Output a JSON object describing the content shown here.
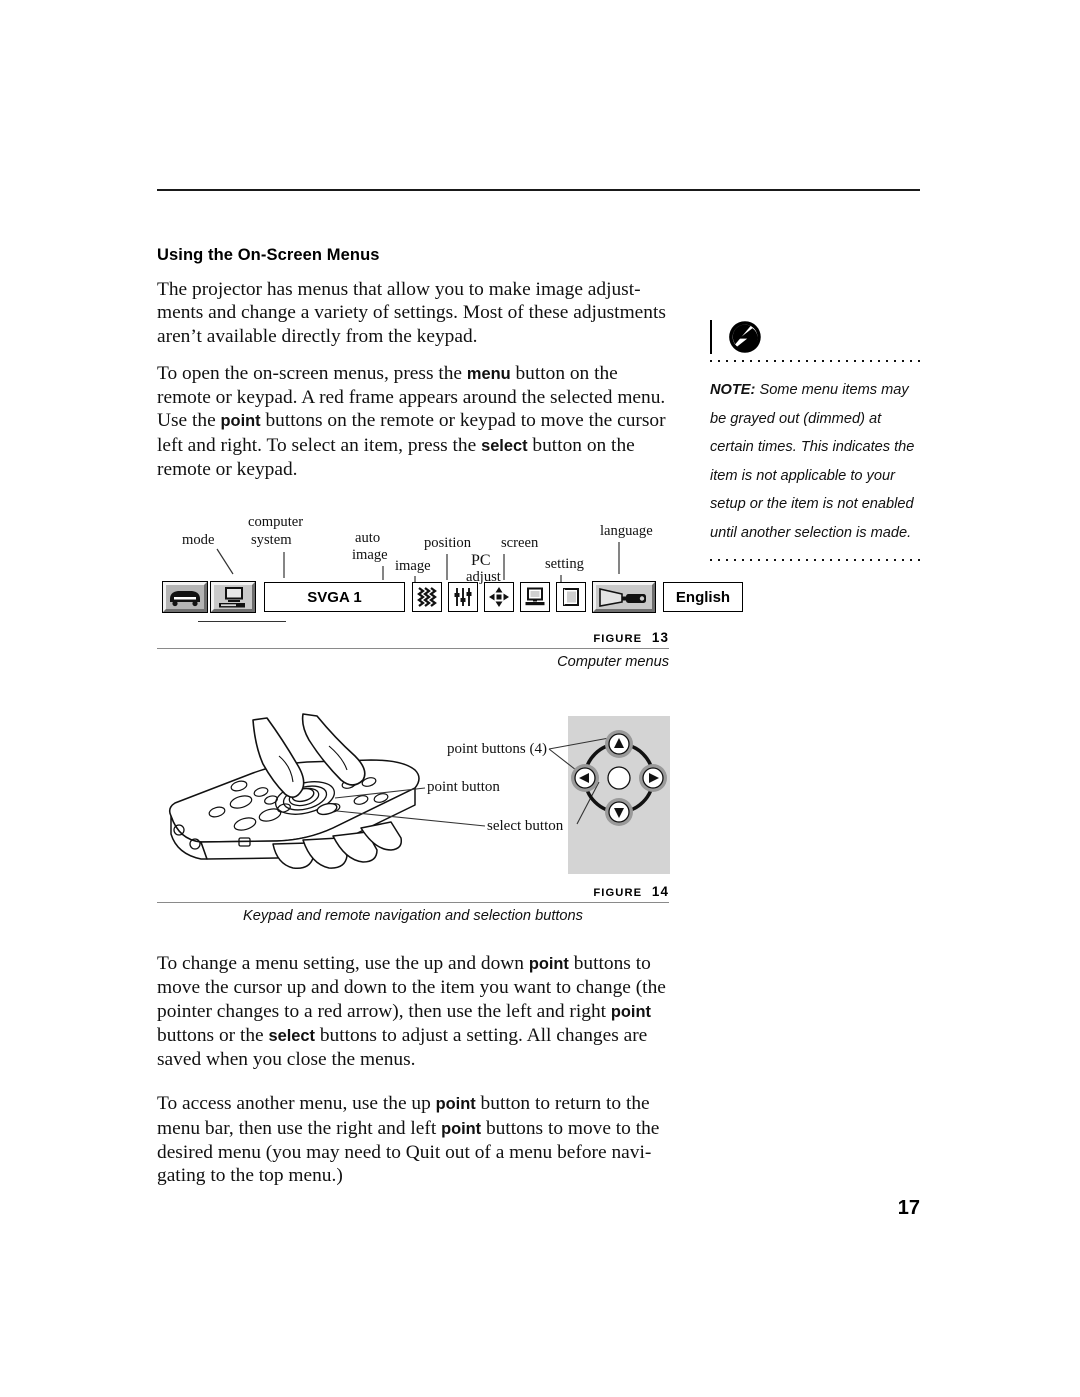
{
  "page": {
    "number": "17"
  },
  "section": {
    "heading": "Using the On-Screen Menus",
    "paragraphs": [
      {
        "id": "p1",
        "runs": [
          {
            "text": "The projector has menus that allow you to make image adjust-ments and change a variety of settings. Most of these adjustments aren’t available directly from the keypad.",
            "bold": false
          }
        ]
      },
      {
        "id": "p2",
        "runs": [
          {
            "text": "To open the on-screen menus, press the ",
            "bold": false
          },
          {
            "text": "menu",
            "bold": true
          },
          {
            "text": " button on the remote or keypad. A red frame appears around the selected menu. Use the ",
            "bold": false
          },
          {
            "text": "point",
            "bold": true
          },
          {
            "text": " buttons on the remote or keypad to move the cursor left and right. To select an item, press the ",
            "bold": false
          },
          {
            "text": "select",
            "bold": true
          },
          {
            "text": " button on the remote or keypad.",
            "bold": false
          }
        ]
      },
      {
        "id": "p3",
        "runs": [
          {
            "text": "To change a menu setting, use the up and down ",
            "bold": false
          },
          {
            "text": "point",
            "bold": true
          },
          {
            "text": " buttons to move the cursor up and down to the item you want to change (the pointer changes to a red arrow), then use the left and right ",
            "bold": false
          },
          {
            "text": "point",
            "bold": true
          },
          {
            "text": " buttons or the ",
            "bold": false
          },
          {
            "text": "select",
            "bold": true
          },
          {
            "text": " buttons to adjust a setting. All changes are saved when you close the menus.",
            "bold": false
          }
        ]
      },
      {
        "id": "p4",
        "runs": [
          {
            "text": "To access another menu, use the up ",
            "bold": false
          },
          {
            "text": "point",
            "bold": true
          },
          {
            "text": " button to return to the menu bar, then use the right and left ",
            "bold": false
          },
          {
            "text": "point",
            "bold": true
          },
          {
            "text": " buttons to move to the desired menu (you may need to Quit out of a menu before navi-gating to the top menu.)",
            "bold": false
          }
        ]
      }
    ]
  },
  "note": {
    "icon": "note-lightning-icon",
    "lead": "NOTE:",
    "body": " Some menu items may be grayed out (dimmed) at certain times. This indicates the item is not applicable to your setup or the item is not enabled until another selection is made."
  },
  "figure13": {
    "caption_label": "FIGURE",
    "caption_number": "13",
    "caption_title": "Computer menus",
    "labels": [
      {
        "name": "mode",
        "text": "mode"
      },
      {
        "name": "computer-system",
        "text": "computer"
      },
      {
        "name": "computer-system-2",
        "text": "system"
      },
      {
        "name": "auto-image",
        "text": "auto"
      },
      {
        "name": "auto-image-2",
        "text": "image"
      },
      {
        "name": "image",
        "text": "image"
      },
      {
        "name": "position",
        "text": "position"
      },
      {
        "name": "pc-adjust",
        "text": "PC"
      },
      {
        "name": "pc-adjust-2",
        "text": "adjust"
      },
      {
        "name": "screen",
        "text": "screen"
      },
      {
        "name": "setting",
        "text": "setting"
      },
      {
        "name": "language",
        "text": "language"
      }
    ],
    "menubar": {
      "system_value": "SVGA 1",
      "language_value": "English",
      "icons": [
        {
          "name": "source-video-icon",
          "label": "mode"
        },
        {
          "name": "computer-monitor-icon",
          "label": "computer system"
        },
        {
          "name": "auto-image-icon",
          "label": "auto image"
        },
        {
          "name": "image-sliders-icon",
          "label": "image"
        },
        {
          "name": "position-arrows-icon",
          "label": "position"
        },
        {
          "name": "pc-adjust-laptop-icon",
          "label": "PC adjust"
        },
        {
          "name": "screen-icon",
          "label": "screen"
        },
        {
          "name": "setting-projector-icon",
          "label": "setting"
        }
      ]
    }
  },
  "figure14": {
    "caption_label": "FIGURE",
    "caption_number": "14",
    "caption_title": "Keypad and remote navigation and selection buttons",
    "callouts": [
      {
        "name": "point-buttons-callout",
        "text": "point buttons (4)"
      },
      {
        "name": "point-button-callout",
        "text": "point button"
      },
      {
        "name": "select-button-callout",
        "text": "select button"
      }
    ],
    "keypad": {
      "up": "▲",
      "down": "▼",
      "left": "◀",
      "right": "▶"
    }
  },
  "colors": {
    "ink": "#000000",
    "rule": "#1a1a1a",
    "caption_rule": "#8a8a8a",
    "panel_gray": "#d4d4d4"
  }
}
